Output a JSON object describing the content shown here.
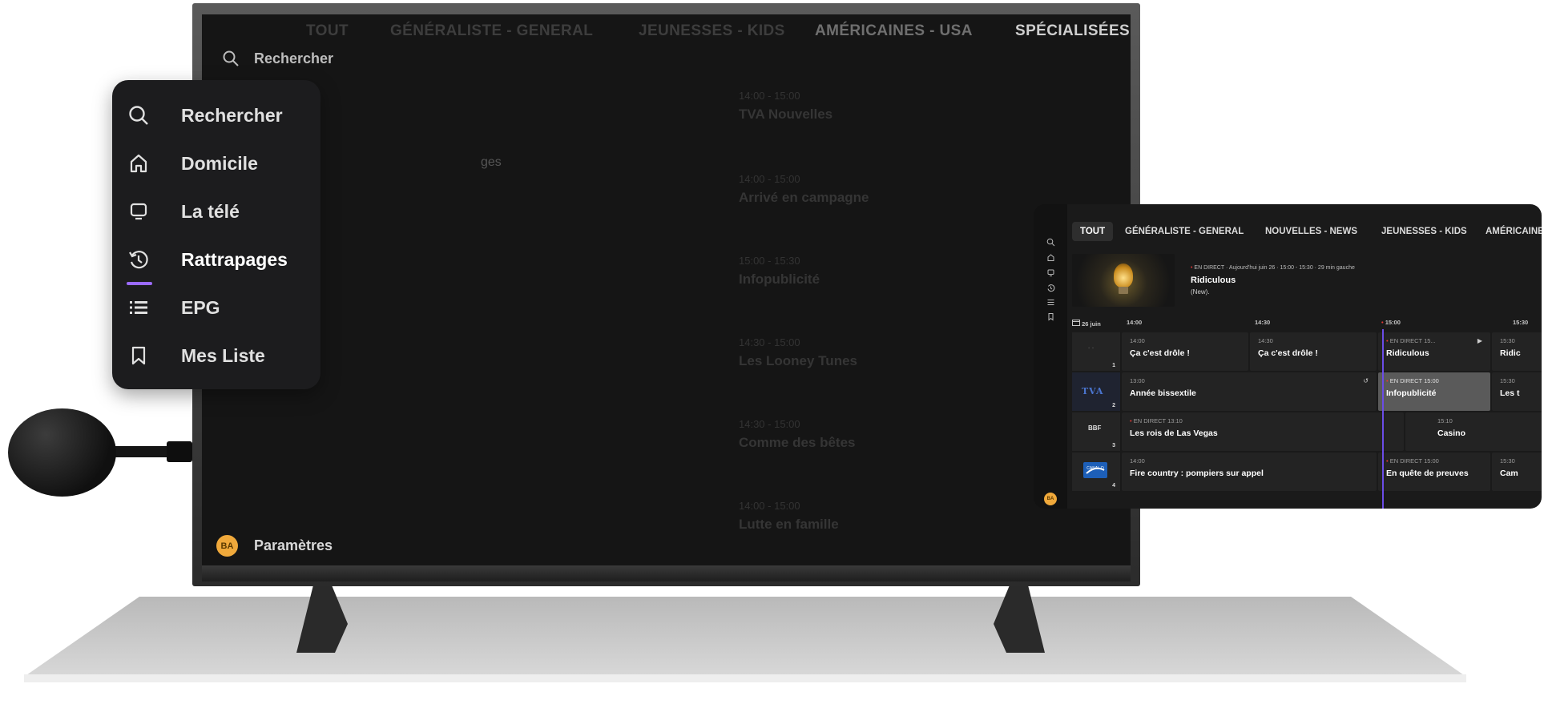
{
  "tv": {
    "tabs": [
      "TOUT",
      "GÉNÉRALISTE - GENERAL",
      "JEUNESSES - KIDS",
      "AMÉRICAINES - USA",
      "SPÉCIALISÉES"
    ],
    "search_label": "Rechercher",
    "settings_label": "Paramètres",
    "avatar_initials": "BA",
    "partial_label": "ges",
    "ghost_programs": [
      {
        "time": "14:00 - 15:00",
        "title": "TVA Nouvelles"
      },
      {
        "time": "14:00 - 15:00",
        "title": "Arrivé en campagne"
      },
      {
        "time": "15:00 - 15:30",
        "title": "Infopublicité"
      },
      {
        "time": "14:30 - 15:00",
        "title": "Les Looney Tunes"
      },
      {
        "time": "14:30 - 15:00",
        "title": "Comme des bêtes"
      },
      {
        "time": "14:00 - 15:00",
        "title": "Lutte en famille"
      }
    ]
  },
  "side_menu": {
    "items": [
      {
        "label": "Rechercher",
        "icon": "search-icon"
      },
      {
        "label": "Domicile",
        "icon": "home-icon"
      },
      {
        "label": "La télé",
        "icon": "tv-icon"
      },
      {
        "label": "Rattrapages",
        "icon": "history-icon"
      },
      {
        "label": "EPG",
        "icon": "list-icon"
      },
      {
        "label": "Mes Liste",
        "icon": "bookmark-icon"
      }
    ],
    "active_index": 3,
    "accent_color": "#9b6bff"
  },
  "epg": {
    "tabs": [
      "TOUT",
      "GÉNÉRALISTE - GENERAL",
      "NOUVELLES - NEWS",
      "JEUNESSES - KIDS",
      "AMÉRICAINE"
    ],
    "hero": {
      "live_label": "EN DIRECT",
      "meta": "Aujourd'hui juin 26 · 15:00 - 15:30 · 29 min gauche",
      "title": "Ridiculous",
      "subtitle": "(New)."
    },
    "timeline": {
      "date": "26 juin",
      "times": [
        "14:00",
        "14:30",
        "15:00",
        "15:30"
      ]
    },
    "avatar_initials": "BA",
    "rows": [
      {
        "channel_num": "1",
        "cells": [
          {
            "time": "14:00",
            "title": "Ça c'est drôle !"
          },
          {
            "time": "14:30",
            "title": "Ça c'est drôle !"
          },
          {
            "time": "EN DIRECT 15...",
            "title": "Ridiculous",
            "live": true
          },
          {
            "time": "15:30",
            "title": "Ridic"
          }
        ]
      },
      {
        "channel_num": "2",
        "logo": "TVA",
        "cells": [
          {
            "time": "13:00",
            "title": "Année bissextile"
          },
          {
            "time": "EN DIRECT 15:00",
            "title": "Infopublicité",
            "live": true
          },
          {
            "time": "15:30",
            "title": "Les t"
          }
        ]
      },
      {
        "channel_num": "3",
        "logo": "BBF",
        "cells": [
          {
            "time": "EN DIRECT 13:10",
            "title": "Les rois de Las Vegas",
            "live": true
          },
          {
            "time": "15:10",
            "title": "Casino"
          }
        ]
      },
      {
        "channel_num": "4",
        "logo": "CANAL D",
        "cells": [
          {
            "time": "14:00",
            "title": "Fire country : pompiers sur appel"
          },
          {
            "time": "EN DIRECT 15:00",
            "title": "En quête de preuves",
            "live": true
          },
          {
            "time": "15:30",
            "title": "Cam"
          }
        ]
      }
    ]
  },
  "colors": {
    "live_dot": "#e53935",
    "now_line": "#6b4ce6",
    "avatar": "#f0a93b"
  }
}
